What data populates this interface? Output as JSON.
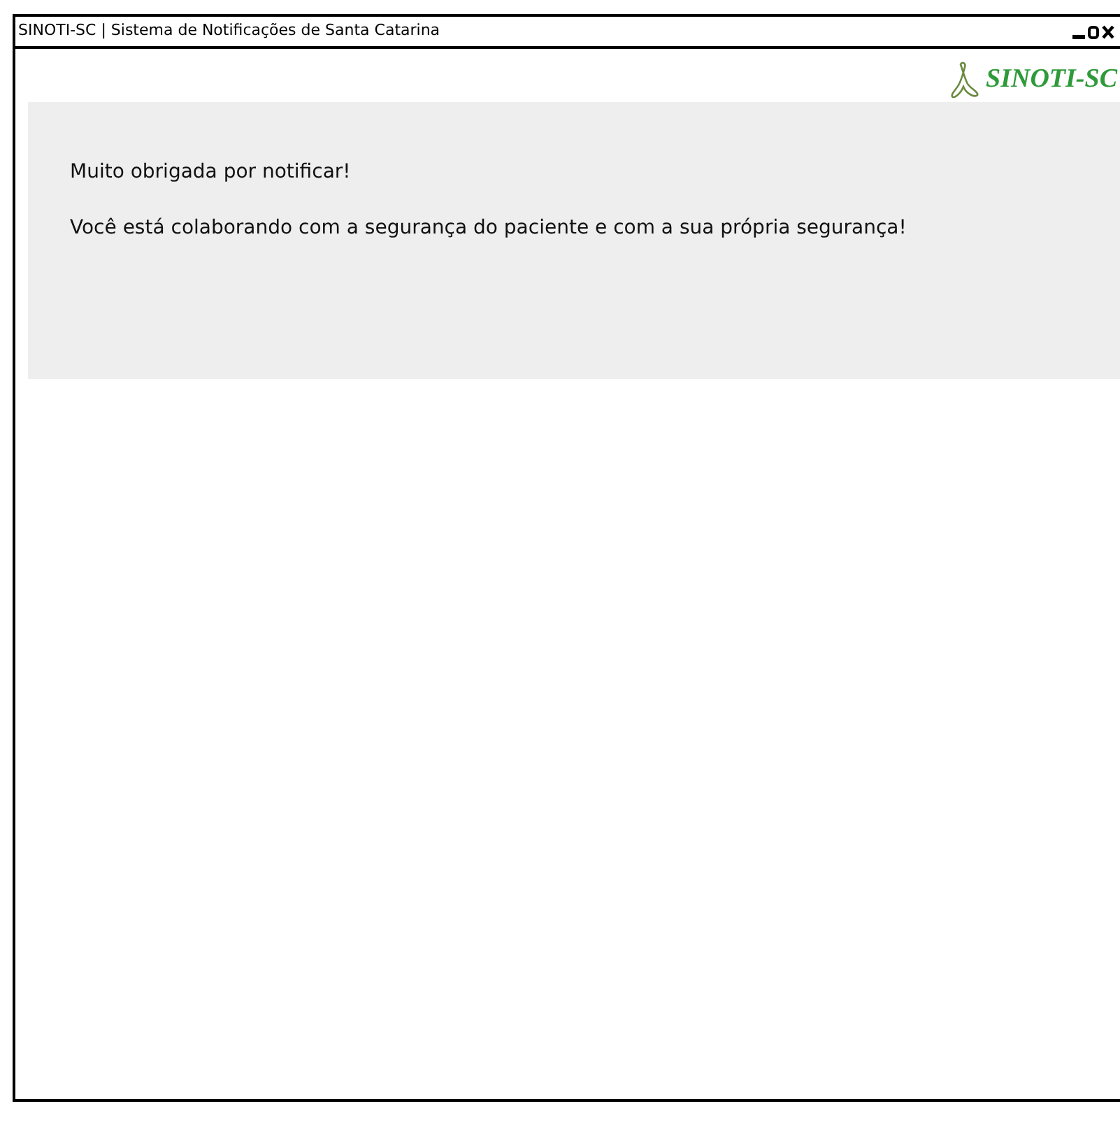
{
  "window": {
    "title": "SINOTI-SC | Sistema de Notificações de Santa Catarina"
  },
  "logo": {
    "text": "SINOTI-SC"
  },
  "message": {
    "lines": [
      "Muito obrigada por notificar!",
      "Você está colaborando com a segurança do paciente e com a sua própria segurança!"
    ]
  }
}
